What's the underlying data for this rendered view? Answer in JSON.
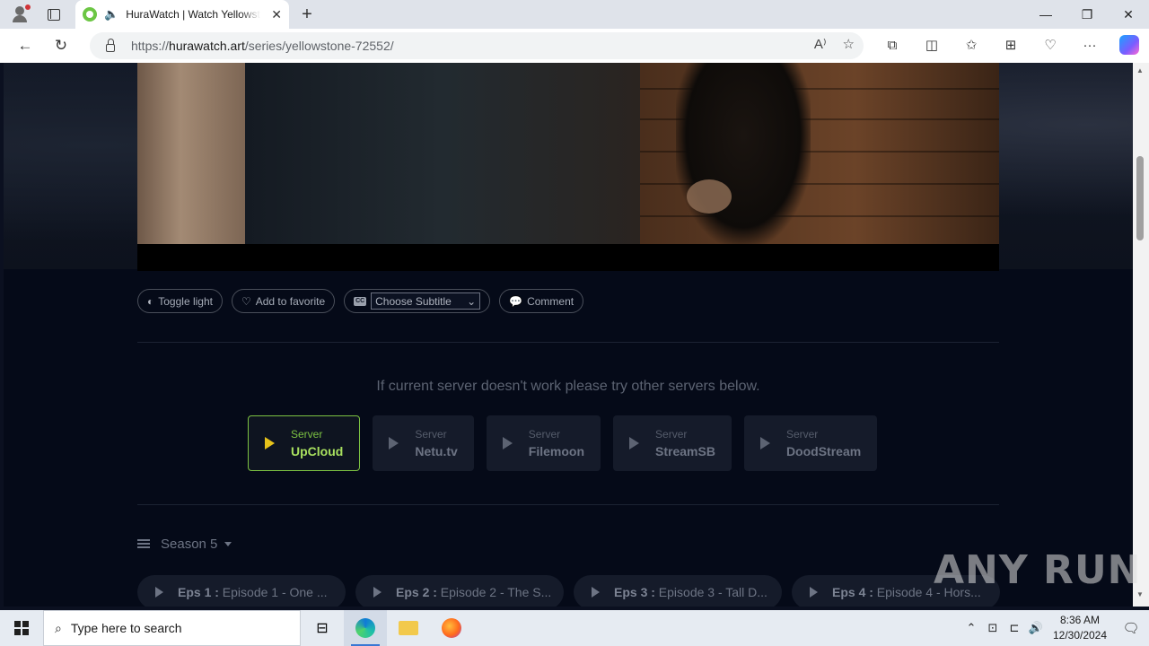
{
  "browser": {
    "tab_title": "HuraWatch | Watch Yellowstone",
    "url_prefix": "https://",
    "url_domain": "hurawatch.art",
    "url_path": "/series/yellowstone-72552/"
  },
  "controls": {
    "toggle_light": "Toggle light",
    "add_favorite": "Add to favorite",
    "subtitle_placeholder": "Choose Subtitle",
    "comment": "Comment"
  },
  "notice": "If current server doesn't work please try other servers below.",
  "servers": [
    {
      "label": "Server",
      "name": "UpCloud",
      "active": true
    },
    {
      "label": "Server",
      "name": "Netu.tv"
    },
    {
      "label": "Server",
      "name": "Filemoon"
    },
    {
      "label": "Server",
      "name": "StreamSB"
    },
    {
      "label": "Server",
      "name": "DoodStream"
    }
  ],
  "season": "Season 5",
  "episodes": [
    {
      "num": "Eps 1 :",
      "title": "Episode 1 - One ..."
    },
    {
      "num": "Eps 2 :",
      "title": "Episode 2 - The S..."
    },
    {
      "num": "Eps 3 :",
      "title": "Episode 3 - Tall D..."
    },
    {
      "num": "Eps 4 :",
      "title": "Episode 4 - Hors..."
    }
  ],
  "watermark": "ANY RUN",
  "taskbar": {
    "search_placeholder": "Type here to search",
    "time": "8:36 AM",
    "date": "12/30/2024"
  },
  "colors": {
    "accent_green": "#7cc242",
    "play_yellow": "#e6c21a",
    "page_bg": "#050a18"
  }
}
